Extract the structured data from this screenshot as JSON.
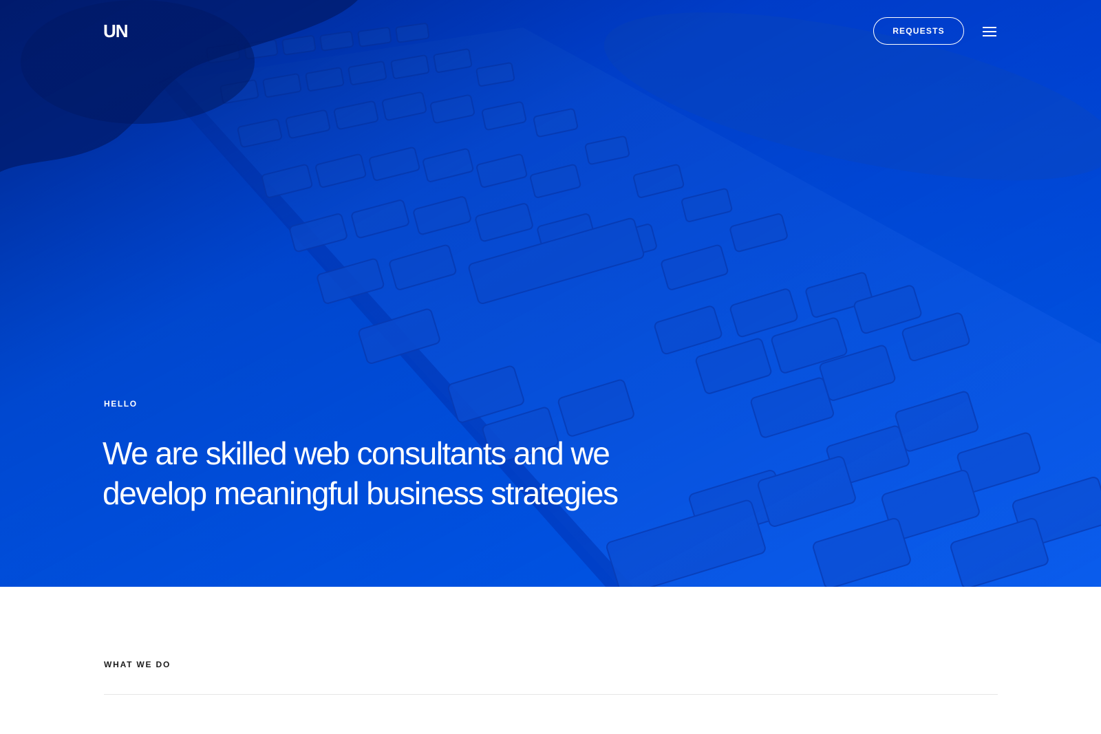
{
  "header": {
    "logo": "UN",
    "requests_label": "REQUESTS",
    "menu_icon": "hamburger-menu-icon"
  },
  "hero": {
    "eyebrow": "HELLO",
    "headline_line1": "We are skilled web consultants and we",
    "headline_line2": "develop meaningful business strategies",
    "background_image": "keyboard photo with blue duotone overlay"
  },
  "section": {
    "label": "WHAT WE DO"
  },
  "colors": {
    "accent_blue": "#0055e6",
    "text_light": "#ffffff",
    "text_dark": "#1c1c1c",
    "divider": "#e6e6e6"
  }
}
